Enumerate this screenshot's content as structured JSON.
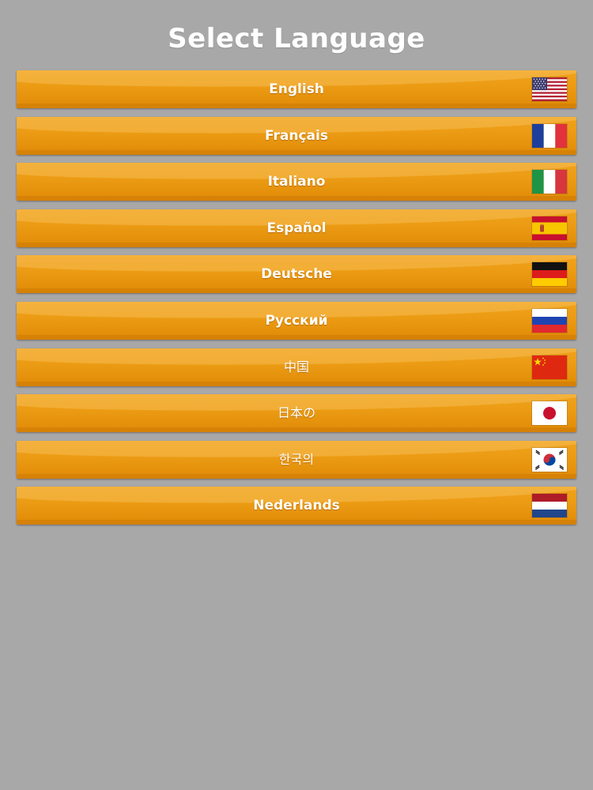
{
  "header": {
    "title": "Select Language"
  },
  "languages": [
    {
      "label": "English",
      "flag_icon": "us-flag-icon"
    },
    {
      "label": "Français",
      "flag_icon": "france-flag-icon"
    },
    {
      "label": "Italiano",
      "flag_icon": "italy-flag-icon"
    },
    {
      "label": "Español",
      "flag_icon": "spain-flag-icon"
    },
    {
      "label": "Deutsche",
      "flag_icon": "germany-flag-icon"
    },
    {
      "label": "Русский",
      "flag_icon": "russia-flag-icon"
    },
    {
      "label": "中国",
      "flag_icon": "china-flag-icon"
    },
    {
      "label": "日本の",
      "flag_icon": "japan-flag-icon"
    },
    {
      "label": "한국의",
      "flag_icon": "korea-flag-icon"
    },
    {
      "label": "Nederlands",
      "flag_icon": "netherlands-flag-icon"
    }
  ],
  "colors": {
    "background": "#a8a8a9",
    "button": "#ec9c14",
    "text": "#ffffff"
  }
}
